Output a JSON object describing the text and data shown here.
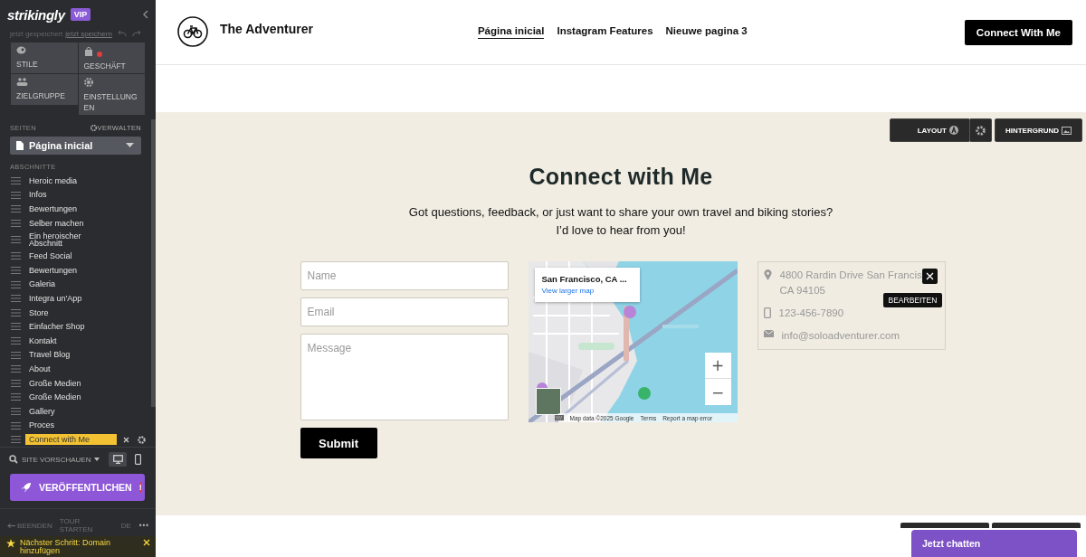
{
  "sidebar": {
    "logo": "strikingly",
    "badge": "VIP",
    "save_status": "jetzt gespeichert",
    "save_link": "jetzt speichern",
    "tools": [
      {
        "kind": "styles",
        "label": "STILE",
        "alert": false
      },
      {
        "kind": "store",
        "label": "GESCHÄFT",
        "alert": true
      },
      {
        "kind": "audience",
        "label": "ZIELGRUPPE",
        "alert": false
      },
      {
        "kind": "settings",
        "label": "EINSTELLUNGEN",
        "alert": false
      }
    ],
    "pages_label": "SEITEN",
    "manage_label": "VERWALTEN",
    "page_select": "Página inicial",
    "sections_label": "ABSCHNITTE",
    "sections": [
      {
        "label": "Heroic media",
        "selected": false
      },
      {
        "label": "Infos",
        "selected": false
      },
      {
        "label": "Bewertungen",
        "selected": false
      },
      {
        "label": "Selber machen",
        "selected": false
      },
      {
        "label": "Ein heroischer Abschnitt",
        "selected": false
      },
      {
        "label": "Feed Social",
        "selected": false
      },
      {
        "label": "Bewertungen",
        "selected": false
      },
      {
        "label": "Galeria",
        "selected": false
      },
      {
        "label": "Integra un'App",
        "selected": false
      },
      {
        "label": "Store",
        "selected": false
      },
      {
        "label": "Einfacher Shop",
        "selected": false
      },
      {
        "label": "Kontakt",
        "selected": false
      },
      {
        "label": "Travel Blog",
        "selected": false
      },
      {
        "label": "About",
        "selected": false
      },
      {
        "label": "Große Medien",
        "selected": false
      },
      {
        "label": "Große Medien",
        "selected": false
      },
      {
        "label": "Gallery",
        "selected": false
      },
      {
        "label": "Proces",
        "selected": false
      },
      {
        "label": "Connect with Me",
        "selected": true
      }
    ],
    "preview_label": "SITE VORSCHAUEN",
    "devices": [
      {
        "kind": "desktop",
        "selected": true
      },
      {
        "kind": "mobile",
        "selected": false
      }
    ],
    "publish": "VERÖFFENTLICHEN",
    "publish_alert": "!",
    "footer": [
      "BEENDEN",
      "TOUR STARTEN",
      "DE",
      "•••"
    ],
    "next_step": "Nächster Schritt: Domain hinzufügen"
  },
  "header": {
    "site_title": "The Adventurer",
    "nav": [
      {
        "label": "Página inicial",
        "selected": true
      },
      {
        "label": "Instagram Features",
        "selected": false
      },
      {
        "label": "Nieuwe pagina 3",
        "selected": false
      }
    ],
    "cta": "Connect With Me"
  },
  "section": {
    "toolbar": {
      "layout": "LAYOUT",
      "background": "HINTERGRUND"
    },
    "title": "Connect with Me",
    "subtitle": [
      "Got questions, feedback, or just want to share your own travel and biking stories?",
      "I’d love to hear from you!"
    ],
    "form": {
      "fields": [
        {
          "kind": "input",
          "placeholder": "Name"
        },
        {
          "kind": "input",
          "placeholder": "Email"
        },
        {
          "kind": "textarea",
          "placeholder": "Message"
        }
      ],
      "submit": "Submit"
    },
    "map": {
      "kind": "picture",
      "place": "San Francisco, CA ...",
      "link": "View larger map",
      "zoom_in": "+",
      "zoom_out": "−",
      "attribution": [
        "Map data ©2025 Google",
        "Terms",
        "Report a map error"
      ]
    },
    "contact": {
      "address": [
        "4800 Rardin Drive San Francis",
        "CA 94105"
      ],
      "phone": "123-456-7890",
      "email": "info@soloadventurer.com",
      "tooltip": "BEARBEITEN"
    }
  },
  "chat": "Jetzt chatten"
}
